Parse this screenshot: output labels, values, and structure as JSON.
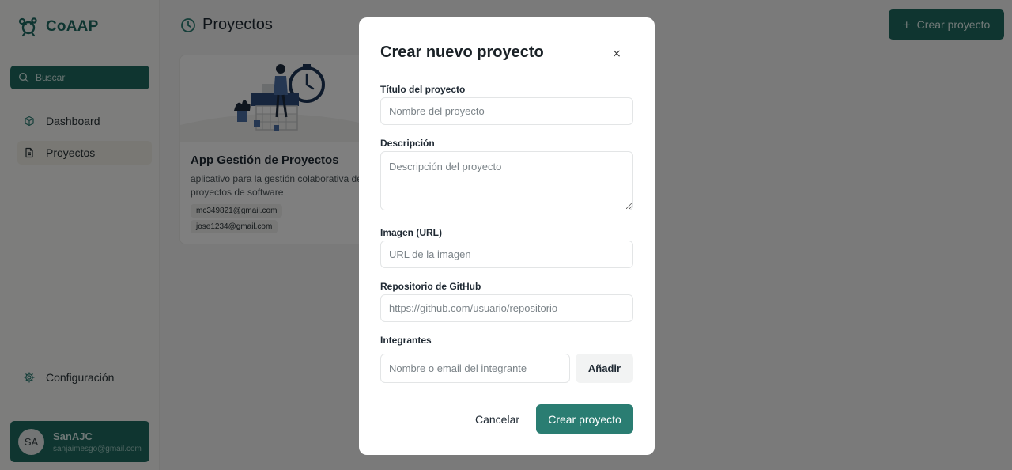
{
  "brand": {
    "name": "CoAAP"
  },
  "sidebar": {
    "search_placeholder": "Buscar",
    "items": [
      {
        "label": "Dashboard",
        "icon": "cube-icon"
      },
      {
        "label": "Proyectos",
        "icon": "document-icon"
      }
    ],
    "settings_label": "Configuración",
    "user": {
      "initials": "SA",
      "name": "SanAJC",
      "email": "sanjaimesgo@gmail.com"
    }
  },
  "header": {
    "title": "Proyectos",
    "create_label": "Crear proyecto"
  },
  "projects": [
    {
      "title": "App Gestión de Proyectos",
      "description": "aplicativo para la gestión colaborativa de proyectos de software",
      "members": [
        "mc349821@gmail.com",
        "jose1234@gmail.com"
      ]
    }
  ],
  "modal": {
    "title": "Crear nuevo proyecto",
    "close_symbol": "×",
    "fields": {
      "title_label": "Título del proyecto",
      "title_placeholder": "Nombre del proyecto",
      "description_label": "Descripción",
      "description_placeholder": "Descripción del proyecto",
      "image_label": "Imagen (URL)",
      "image_placeholder": "URL de la imagen",
      "repo_label": "Repositorio de GitHub",
      "repo_placeholder": "https://github.com/usuario/repositorio",
      "members_label": "Integrantes",
      "members_placeholder": "Nombre o email del integrante"
    },
    "add_label": "Añadir",
    "cancel_label": "Cancelar",
    "submit_label": "Crear proyecto"
  },
  "colors": {
    "primary": "#1f6b60",
    "submit": "#2a7d72",
    "overlay": "rgba(0,0,0,0.5)"
  }
}
